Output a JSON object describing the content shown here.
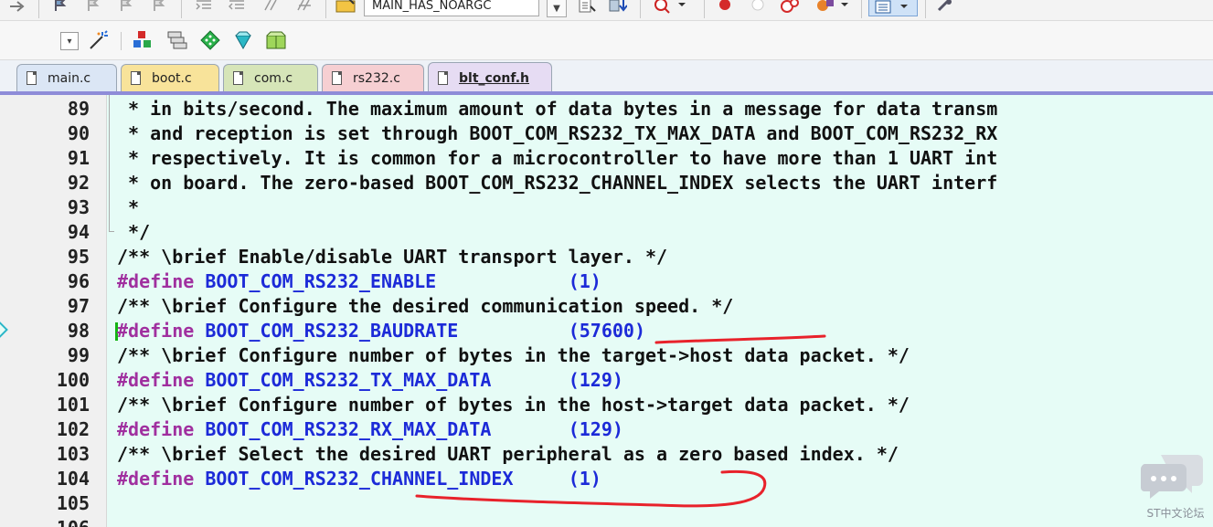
{
  "toolbar1": {
    "target_combo": "MAIN_HAS_NOARGC",
    "icons": [
      "arrow-right-icon",
      "bookmark-icon",
      "bookmark-prev-icon",
      "bookmark-next-icon",
      "bookmark-clear-icon",
      "indent-icon",
      "unindent-icon",
      "comment-icon",
      "uncomment-icon",
      "open-folder-icon",
      "target-dropdown-icon",
      "build-icon",
      "download-icon",
      "debug-icon",
      "breakpoint-icon",
      "breakpoint-disabled-icon",
      "kill-breakpoints-icon",
      "config-icon",
      "window-layout-icon",
      "wrench-icon"
    ]
  },
  "toolbar2": {
    "icons": [
      "options-dropdown-icon",
      "magic-wand-icon",
      "manage-project-icon",
      "stack-icon",
      "green-diamond-icon",
      "gem-icon",
      "package-icon"
    ]
  },
  "tabs": [
    {
      "label": "main.c",
      "color": "#dbe6f5"
    },
    {
      "label": "boot.c",
      "color": "#f8e39a"
    },
    {
      "label": "com.c",
      "color": "#d6e5b8"
    },
    {
      "label": "rs232.c",
      "color": "#f6cfd2"
    },
    {
      "label": "blt_conf.h",
      "color": "#e6dcf3",
      "active": true
    }
  ],
  "editor": {
    "lines": [
      {
        "num": "89",
        "segments": [
          {
            "t": " * in bits/second. The maximum amount of data bytes in a message for data transm",
            "c": "comment"
          }
        ]
      },
      {
        "num": "90",
        "segments": [
          {
            "t": " * and reception is set through BOOT_COM_RS232_TX_MAX_DATA and BOOT_COM_RS232_RX",
            "c": "comment"
          }
        ]
      },
      {
        "num": "91",
        "segments": [
          {
            "t": " * respectively. It is common for a microcontroller to have more than 1 UART int",
            "c": "comment"
          }
        ]
      },
      {
        "num": "92",
        "segments": [
          {
            "t": " * on board. The zero-based BOOT_COM_RS232_CHANNEL_INDEX selects the UART interf",
            "c": "comment"
          }
        ]
      },
      {
        "num": "93",
        "segments": [
          {
            "t": " *",
            "c": "comment"
          }
        ]
      },
      {
        "num": "94",
        "segments": [
          {
            "t": " */",
            "c": "comment"
          }
        ]
      },
      {
        "num": "95",
        "segments": [
          {
            "t": "/** \\brief Enable/disable UART transport layer. */",
            "c": "comment"
          }
        ]
      },
      {
        "num": "96",
        "segments": [
          {
            "t": "#define",
            "c": "kw"
          },
          {
            "t": " BOOT_COM_RS232_ENABLE            ",
            "c": "macro"
          },
          {
            "t": "(1)",
            "c": "num"
          }
        ]
      },
      {
        "num": "97",
        "segments": [
          {
            "t": "/** \\brief Configure the desired communication speed. */",
            "c": "comment"
          }
        ]
      },
      {
        "num": "98",
        "segments": [
          {
            "t": "#define",
            "c": "kw"
          },
          {
            "t": " BOOT_COM_RS232_BAUDRATE          ",
            "c": "macro"
          },
          {
            "t": "(57600)",
            "c": "num"
          }
        ],
        "marker": true
      },
      {
        "num": "99",
        "segments": [
          {
            "t": "/** \\brief Configure number of bytes in the target->host data packet. */",
            "c": "comment"
          }
        ]
      },
      {
        "num": "100",
        "segments": [
          {
            "t": "#define",
            "c": "kw"
          },
          {
            "t": " BOOT_COM_RS232_TX_MAX_DATA       ",
            "c": "macro"
          },
          {
            "t": "(129)",
            "c": "num"
          }
        ]
      },
      {
        "num": "101",
        "segments": [
          {
            "t": "/** \\brief Configure number of bytes in the host->target data packet. */",
            "c": "comment"
          }
        ]
      },
      {
        "num": "102",
        "segments": [
          {
            "t": "#define",
            "c": "kw"
          },
          {
            "t": " BOOT_COM_RS232_RX_MAX_DATA       ",
            "c": "macro"
          },
          {
            "t": "(129)",
            "c": "num"
          }
        ]
      },
      {
        "num": "103",
        "segments": [
          {
            "t": "/** \\brief Select the desired UART peripheral as a zero based index. */",
            "c": "comment"
          }
        ]
      },
      {
        "num": "104",
        "segments": [
          {
            "t": "#define",
            "c": "kw"
          },
          {
            "t": " BOOT_COM_RS232_CHANNEL_INDEX     ",
            "c": "macro"
          },
          {
            "t": "(1)",
            "c": "num"
          }
        ]
      },
      {
        "num": "105",
        "segments": []
      },
      {
        "num": "106",
        "segments": []
      }
    ]
  },
  "watermark": {
    "text": "ST中文论坛"
  },
  "colors": {
    "annotation_red": "#e8222b",
    "editor_bg": "#e6fcf6",
    "keyword": "#a0309f",
    "macro": "#1c2ad8"
  }
}
